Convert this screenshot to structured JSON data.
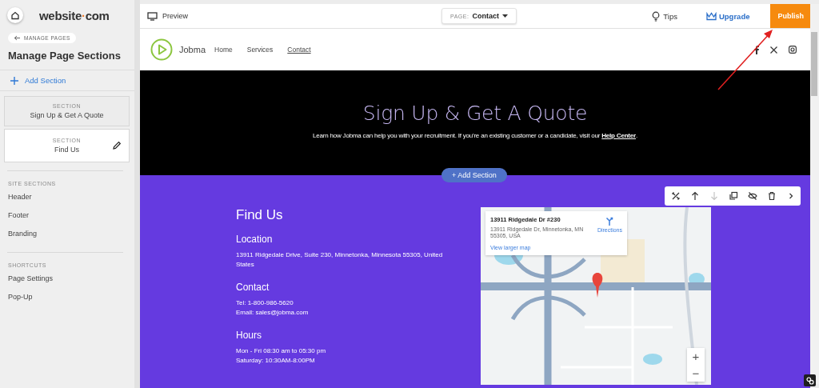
{
  "brand": [
    {
      "text": "website",
      "accent": false
    },
    {
      "text": "·",
      "accent": true
    },
    {
      "text": "com",
      "accent": false
    }
  ],
  "sidebar": {
    "back_link": "MANAGE PAGES",
    "title": "Manage Page Sections",
    "add_section": "Add Section",
    "sections": [
      {
        "label": "SECTION",
        "name": "Sign Up & Get A Quote",
        "selected": false
      },
      {
        "label": "SECTION",
        "name": "Find Us",
        "selected": true
      }
    ],
    "groups": [
      {
        "heading": "SITE SECTIONS",
        "items": [
          "Header",
          "Footer",
          "Branding"
        ]
      },
      {
        "heading": "SHORTCUTS",
        "items": [
          "Page Settings",
          "Pop-Up"
        ]
      }
    ]
  },
  "topbar": {
    "preview": "Preview",
    "page_label": "PAGE:",
    "page_value": "Contact",
    "tips": "Tips",
    "upgrade": "Upgrade",
    "publish": "Publish"
  },
  "site": {
    "logo": "Jobma",
    "nav": [
      {
        "label": "Home",
        "selected": false
      },
      {
        "label": "Services",
        "selected": false
      },
      {
        "label": "Contact",
        "selected": true
      }
    ]
  },
  "hero": {
    "title": "Sign Up & Get A Quote",
    "text": "Learn how Jobma can help you with your recruitment. If you're an existing customer or a candidate, visit our ",
    "link": "Help Center",
    "text_end": "."
  },
  "add_section": "+ Add Section",
  "section_tools": [
    {
      "kind": "tools",
      "disabled": false
    },
    {
      "kind": "up",
      "disabled": false
    },
    {
      "kind": "down",
      "disabled": true
    },
    {
      "kind": "copy",
      "disabled": false
    },
    {
      "kind": "hide",
      "disabled": false
    },
    {
      "kind": "delete",
      "disabled": false
    },
    {
      "kind": "more",
      "disabled": false
    }
  ],
  "find_us": {
    "title": "Find Us",
    "blocks": [
      {
        "heading": "Location",
        "lines": [
          "13911 Ridgedale Drive, Suite 230, Minnetonka, Minnesota 55305, United States"
        ]
      },
      {
        "heading": "Contact",
        "lines": [
          "Tel: 1-800-986-5620",
          "Email: sales@jobma.com"
        ]
      },
      {
        "heading": "Hours",
        "lines": [
          "Mon - Fri 08:30 am to 05:30 pm",
          "Saturday: 10:30AM-8:00PM"
        ]
      }
    ]
  },
  "map": {
    "kind": "picture",
    "card_title": "13911 Ridgedale Dr #230",
    "card_address": "13911 Ridgedale Dr, Minnetonka, MN 55305, USA",
    "directions": "Directions",
    "larger_map": "View larger map",
    "zoom_in": "+",
    "zoom_out": "−"
  }
}
